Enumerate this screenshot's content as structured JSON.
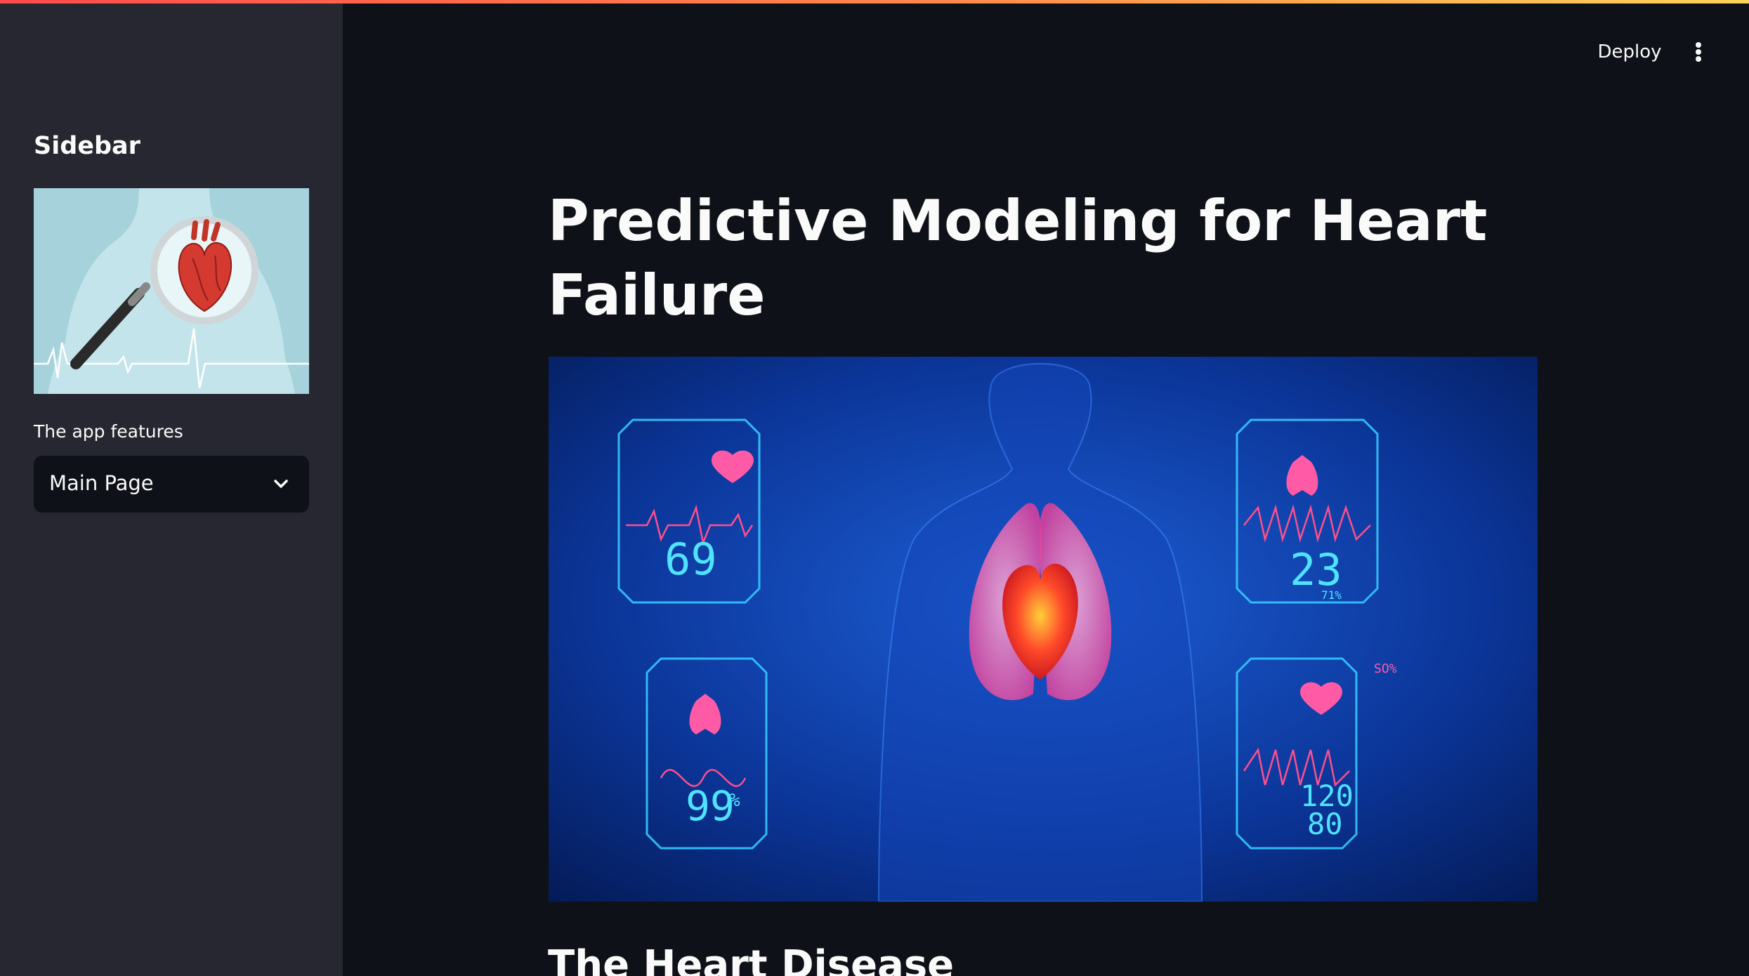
{
  "header": {
    "deploy_label": "Deploy",
    "menu_icon": "vertical-ellipsis-icon"
  },
  "sidebar": {
    "title": "Sidebar",
    "image_icon": "heart-magnifier-illustration",
    "features_label": "The app features",
    "select": {
      "value": "Main Page"
    }
  },
  "main": {
    "title": "Predictive Modeling for Heart Failure",
    "hero_image": {
      "readouts": [
        "69",
        "23",
        "71%",
        "99",
        "%",
        "120",
        "80",
        "SO%"
      ]
    },
    "section_heading": "The Heart Disease"
  },
  "colors": {
    "app_background": "#0e1117",
    "sidebar_background": "#262730",
    "text": "#fafafa",
    "accent_gradient_start": "#ff4b4b",
    "accent_gradient_end": "#fdd35a"
  }
}
